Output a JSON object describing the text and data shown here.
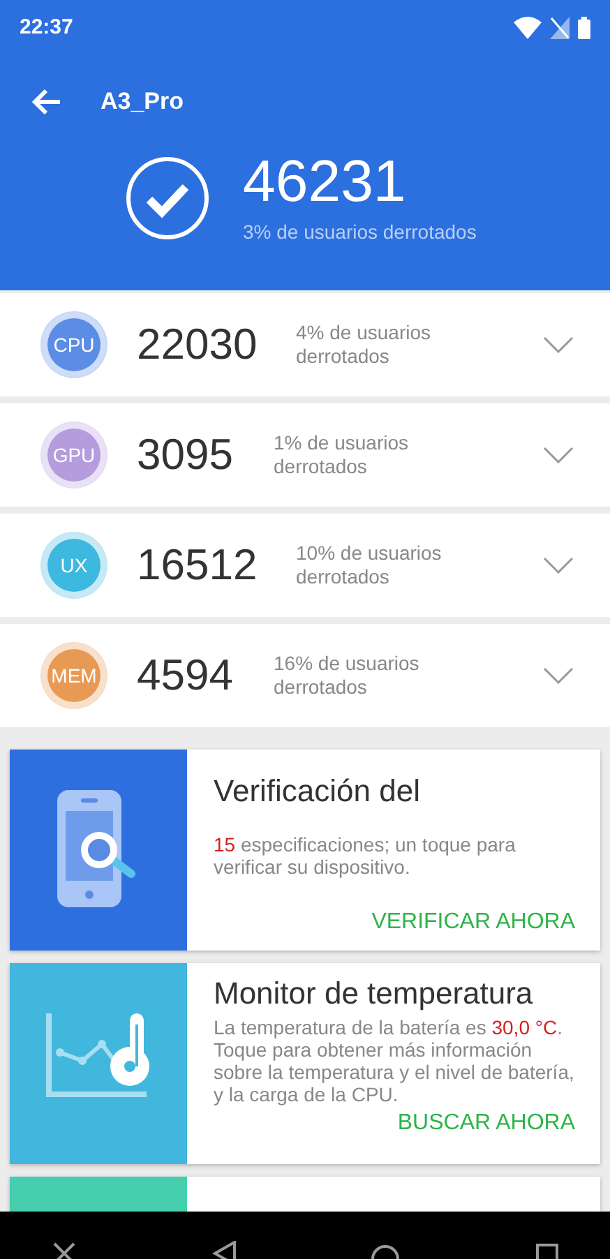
{
  "status_bar": {
    "time": "22:37"
  },
  "header": {
    "title": "A3_Pro",
    "score": "46231",
    "subtitle": "3% de usuarios derrotados"
  },
  "scores": [
    {
      "label": "CPU",
      "score": "22030",
      "note": "4% de usuarios derrotados",
      "color": "#5b8de6",
      "expanded": false
    },
    {
      "label": "GPU",
      "score": "3095",
      "note": "1% de usuarios derrotados",
      "color": "#b49cdd",
      "expanded": false
    },
    {
      "label": "UX",
      "score": "16512",
      "note": "10% de usuarios derrotados",
      "color": "#3db8de",
      "expanded": false
    },
    {
      "label": "MEM",
      "score": "4594",
      "note": "16% de usuarios derrotados",
      "color": "#e89a55",
      "expanded": false
    }
  ],
  "cards": [
    {
      "kind": "verify",
      "title": "Verificación del",
      "description": [
        {
          "text": "15",
          "highlight": true
        },
        {
          "text": " especificaciones; un toque para verificar su dispositivo.",
          "highlight": false
        }
      ],
      "action": "VERIFICAR AHORA"
    },
    {
      "kind": "temperature",
      "title": "Monitor de temperatura",
      "description": [
        {
          "text": "La temperatura de la batería es ",
          "highlight": false
        },
        {
          "text": "30,0 °C",
          "highlight": true
        },
        {
          "text": ". Toque para obtener más información sobre la temperatura y el nivel de batería, y la carga de la CPU.",
          "highlight": false
        }
      ],
      "action": "BUSCAR AHORA"
    },
    {
      "kind": "stress"
    }
  ]
}
